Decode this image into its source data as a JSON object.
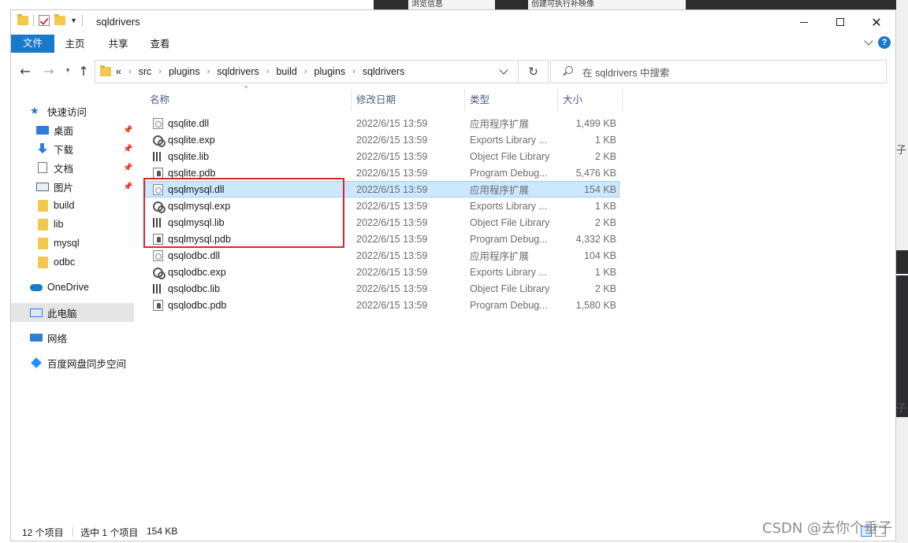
{
  "background": {
    "top_tab_1": "浏览信息",
    "top_tab_2": "创建可执行补映像",
    "right_fragments": [
      "子",
      "子"
    ]
  },
  "window": {
    "title": "sqldrivers",
    "ribbon_tabs": [
      "文件",
      "主页",
      "共享",
      "查看"
    ]
  },
  "address": {
    "overflow": "«",
    "crumbs": [
      "src",
      "plugins",
      "sqldrivers",
      "build",
      "plugins",
      "sqldrivers"
    ]
  },
  "search": {
    "placeholder": "在 sqldrivers 中搜索"
  },
  "sidebar": {
    "items": [
      {
        "label": "快速访问",
        "icon": "star-icon",
        "pinned": false
      },
      {
        "label": "桌面",
        "icon": "desktop-icon",
        "pinned": true
      },
      {
        "label": "下载",
        "icon": "download-icon",
        "pinned": true
      },
      {
        "label": "文档",
        "icon": "document-icon",
        "pinned": true
      },
      {
        "label": "图片",
        "icon": "pictures-icon",
        "pinned": true
      },
      {
        "label": "build",
        "icon": "folder-icon",
        "pinned": false
      },
      {
        "label": "lib",
        "icon": "folder-icon",
        "pinned": false
      },
      {
        "label": "mysql",
        "icon": "folder-icon",
        "pinned": false
      },
      {
        "label": "odbc",
        "icon": "folder-icon",
        "pinned": false
      },
      {
        "label": "OneDrive",
        "icon": "cloud-icon",
        "pinned": false
      },
      {
        "label": "此电脑",
        "icon": "computer-icon",
        "pinned": false
      },
      {
        "label": "网络",
        "icon": "network-icon",
        "pinned": false
      },
      {
        "label": "百度网盘同步空间",
        "icon": "baidu-icon",
        "pinned": false
      }
    ],
    "selected_index": 10
  },
  "columns": {
    "name": "名称",
    "date": "修改日期",
    "type": "类型",
    "size": "大小"
  },
  "files": [
    {
      "name": "qsqlite.dll",
      "date": "2022/6/15 13:59",
      "type": "应用程序扩展",
      "size": "1,499 KB",
      "kind": "dll"
    },
    {
      "name": "qsqlite.exp",
      "date": "2022/6/15 13:59",
      "type": "Exports Library ...",
      "size": "1 KB",
      "kind": "exp"
    },
    {
      "name": "qsqlite.lib",
      "date": "2022/6/15 13:59",
      "type": "Object File Library",
      "size": "2 KB",
      "kind": "lib"
    },
    {
      "name": "qsqlite.pdb",
      "date": "2022/6/15 13:59",
      "type": "Program Debug...",
      "size": "5,476 KB",
      "kind": "pdb"
    },
    {
      "name": "qsqlmysql.dll",
      "date": "2022/6/15 13:59",
      "type": "应用程序扩展",
      "size": "154 KB",
      "kind": "dll"
    },
    {
      "name": "qsqlmysql.exp",
      "date": "2022/6/15 13:59",
      "type": "Exports Library ...",
      "size": "1 KB",
      "kind": "exp"
    },
    {
      "name": "qsqlmysql.lib",
      "date": "2022/6/15 13:59",
      "type": "Object File Library",
      "size": "2 KB",
      "kind": "lib"
    },
    {
      "name": "qsqlmysql.pdb",
      "date": "2022/6/15 13:59",
      "type": "Program Debug...",
      "size": "4,332 KB",
      "kind": "pdb"
    },
    {
      "name": "qsqlodbc.dll",
      "date": "2022/6/15 13:59",
      "type": "应用程序扩展",
      "size": "104 KB",
      "kind": "dll"
    },
    {
      "name": "qsqlodbc.exp",
      "date": "2022/6/15 13:59",
      "type": "Exports Library ...",
      "size": "1 KB",
      "kind": "exp"
    },
    {
      "name": "qsqlodbc.lib",
      "date": "2022/6/15 13:59",
      "type": "Object File Library",
      "size": "2 KB",
      "kind": "lib"
    },
    {
      "name": "qsqlodbc.pdb",
      "date": "2022/6/15 13:59",
      "type": "Program Debug...",
      "size": "1,580 KB",
      "kind": "pdb"
    }
  ],
  "selected_file_index": 4,
  "status": {
    "count": "12 个项目",
    "selected": "选中 1 个项目",
    "selected_size": "154 KB"
  },
  "watermark": "CSDN @去你个垂子",
  "colors": {
    "accent": "#1979ca",
    "selection": "#cce8ff",
    "highlight_box": "#d9262c"
  }
}
